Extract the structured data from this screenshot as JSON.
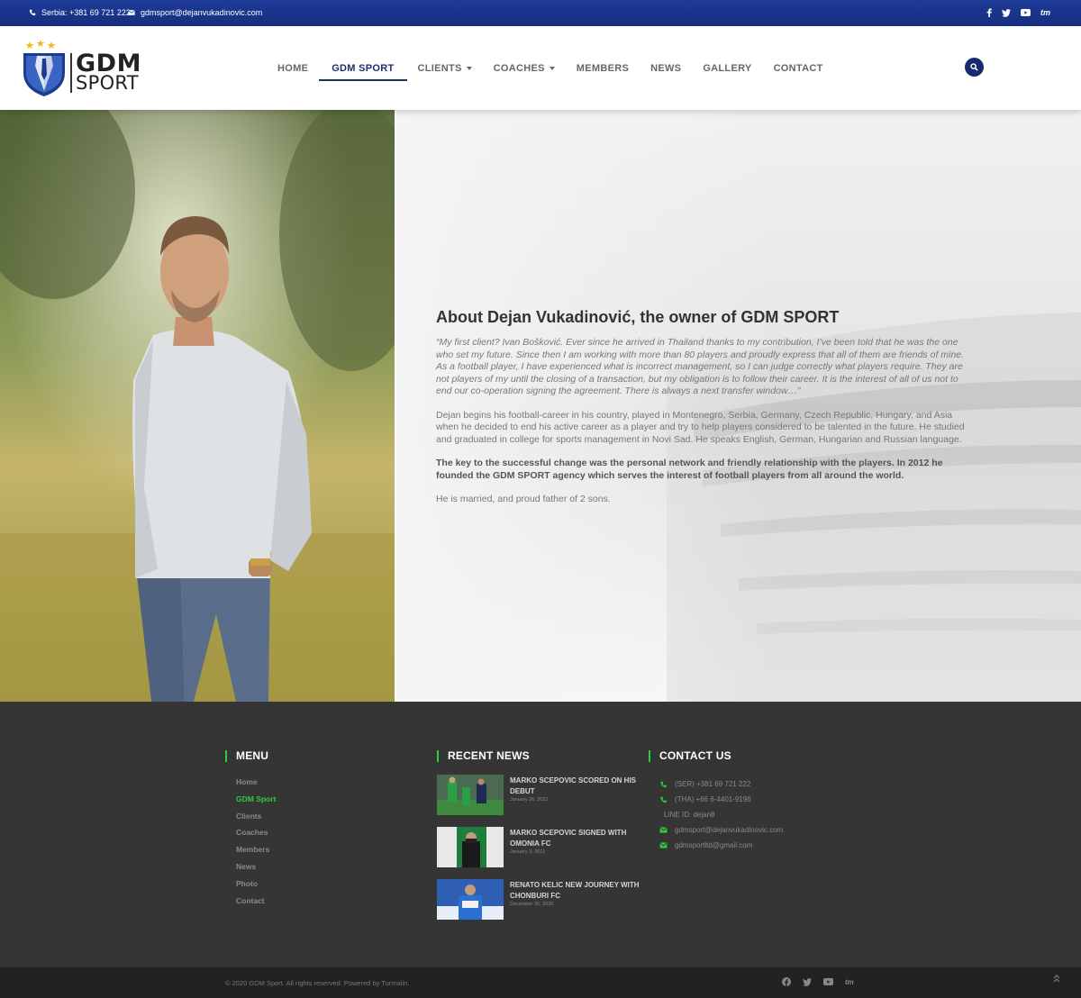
{
  "topbar": {
    "phone": "Serbia: +381 69 721 222",
    "email": "gdmsport@dejanvukadinovic.com",
    "socials": [
      "facebook-icon",
      "twitter-icon",
      "youtube-icon",
      "tm"
    ]
  },
  "header": {
    "logo_line1": "GDM",
    "logo_line2": "SPORT",
    "nav": [
      {
        "label": "HOME"
      },
      {
        "label": "GDM SPORT",
        "active": true
      },
      {
        "label": "CLIENTS",
        "dropdown": true
      },
      {
        "label": "COACHES",
        "dropdown": true
      },
      {
        "label": "MEMBERS"
      },
      {
        "label": "NEWS"
      },
      {
        "label": "GALLERY"
      },
      {
        "label": "CONTACT"
      }
    ]
  },
  "about": {
    "title": "About Dejan Vukadinović, the owner of GDM SPORT",
    "quote": "“My first client? Ivan Bošković. Ever since he arrived in Thailand thanks to my contribution, I’ve been told that he was the one who set my future. Since then I am working with more than 80 players and proudly express that all of them are friends of mine. As a football player, I have experienced what is incorrect management, so I can judge correctly what players require. They are not players of my until the closing of a transaction, but my obligation is to follow their career. It is the interest of all of us not to end our co-operation signing the agreement. There is always a next transfer window…”",
    "p1": "Dejan begins his football-career in his country, played in Montenegro, Serbia, Germany, Czech Republic, Hungary, and Asia when he decided to end his active career as a player and try to help players considered to be talented in the future. He studied and graduated in college for sports management in Novi Sad. He speaks English, German, Hungarian and Russian language.",
    "p2": "The key to the successful change was the personal network and friendly relationship with the players. In 2012 he founded the GDM SPORT agency which serves the interest of football players from all around the world.",
    "p3": "He is married, and proud father of 2 sons."
  },
  "footer": {
    "menu_title": "MENU",
    "menu": [
      {
        "label": "Home"
      },
      {
        "label": "GDM Sport",
        "active": true
      },
      {
        "label": "Clients"
      },
      {
        "label": "Coaches"
      },
      {
        "label": "Members"
      },
      {
        "label": "News"
      },
      {
        "label": "Photo"
      },
      {
        "label": "Contact"
      }
    ],
    "news_title": "RECENT NEWS",
    "news": [
      {
        "title": "MARKO SCEPOVIC SCORED ON HIS DEBUT",
        "date": "January 26, 2021"
      },
      {
        "title": "MARKO SCEPOVIC SIGNED WITH OMONIA FC",
        "date": "January 3, 2021"
      },
      {
        "title": "RENATO KELIC NEW JOURNEY WITH CHONBURI FC",
        "date": "December 30, 2020"
      }
    ],
    "contact_title": "CONTACT US",
    "contacts": [
      {
        "icon": "phone-icon",
        "text": "(SER) +381 69 721 222"
      },
      {
        "icon": "phone-icon",
        "text": "(THA) +66 6-4401-9196"
      },
      {
        "icon": "",
        "text": "LINE ID: dejan8"
      },
      {
        "icon": "mail-icon",
        "text": "gdmsport@dejanvukadinovic.com"
      },
      {
        "icon": "mail-icon",
        "text": "gdmsportltd@gmail.com"
      }
    ],
    "copyright": "© 2020 GDM Sport. All rights reserved. Powered by Turmalin.",
    "tm_label": "tm",
    "colors": {
      "accent": "#2ecc40",
      "brand": "#1b2f6b"
    }
  }
}
